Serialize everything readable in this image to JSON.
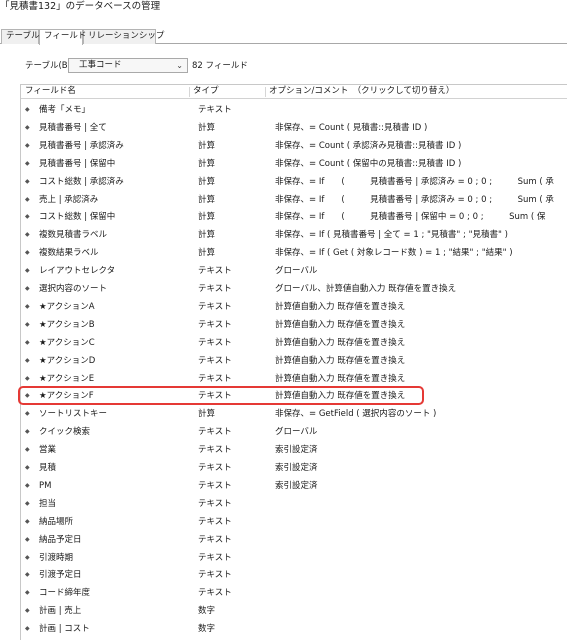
{
  "window": {
    "title": "「見積書132」のデータベースの管理"
  },
  "tabs": [
    {
      "label": "テーブル"
    },
    {
      "label": "フィールド"
    },
    {
      "label": "リレーションシップ"
    }
  ],
  "table_selector": {
    "label": "テーブル(B):",
    "selected": "工事コード",
    "field_count": "82 フィールド"
  },
  "columns": {
    "name": "フィールド名",
    "type": "タイプ",
    "options": "オプション/コメント　（クリックして切り替え）"
  },
  "rows": [
    {
      "name": "備考「メモ」",
      "type": "テキスト",
      "opt": ""
    },
    {
      "name": "見積書番号 | 全て",
      "type": "計算",
      "opt": "非保存、= Count ( 見積書::見積書 ID )"
    },
    {
      "name": "見積書番号 | 承認済み",
      "type": "計算",
      "opt": "非保存、= Count ( 承認済み見積書::見積書 ID )"
    },
    {
      "name": "見積書番号 | 保留中",
      "type": "計算",
      "opt": "非保存、= Count ( 保留中の見積書::見積書 ID )"
    },
    {
      "name": "コスト総数 | 承認済み",
      "type": "計算",
      "opt": "非保存、= If　　(　　　見積書番号 | 承認済み = 0 ; 0 ;　　　Sum ( 承"
    },
    {
      "name": "売上 | 承認済み",
      "type": "計算",
      "opt": "非保存、= If　　(　　　見積書番号 | 承認済み = 0 ; 0 ;　　　Sum ( 承"
    },
    {
      "name": "コスト総数 | 保留中",
      "type": "計算",
      "opt": "非保存、= If　　(　　　見積書番号 | 保留中 = 0 ; 0 ;　　　Sum ( 保"
    },
    {
      "name": "複数見積書ラベル",
      "type": "計算",
      "opt": "非保存、= If ( 見積書番号 | 全て = 1 ; \"見積書\" ; \"見積書\" )"
    },
    {
      "name": "複数結果ラベル",
      "type": "計算",
      "opt": "非保存、= If ( Get ( 対象レコード数 ) = 1 ; \"結果\" ; \"結果\" )"
    },
    {
      "name": "レイアウトセレクタ",
      "type": "テキスト",
      "opt": "グローバル"
    },
    {
      "name": "選択内容のソート",
      "type": "テキスト",
      "opt": "グローバル、計算値自動入力 既存値を置き換え"
    },
    {
      "name": "★アクションA",
      "type": "テキスト",
      "opt": "計算値自動入力 既存値を置き換え"
    },
    {
      "name": "★アクションB",
      "type": "テキスト",
      "opt": "計算値自動入力 既存値を置き換え"
    },
    {
      "name": "★アクションC",
      "type": "テキスト",
      "opt": "計算値自動入力 既存値を置き換え"
    },
    {
      "name": "★アクションD",
      "type": "テキスト",
      "opt": "計算値自動入力 既存値を置き換え"
    },
    {
      "name": "★アクションE",
      "type": "テキスト",
      "opt": "計算値自動入力 既存値を置き換え"
    },
    {
      "name": "★アクションF",
      "type": "テキスト",
      "opt": "計算値自動入力 既存値を置き換え"
    },
    {
      "name": "ソートリストキー",
      "type": "計算",
      "opt": "非保存、= GetField ( 選択内容のソート )"
    },
    {
      "name": "クイック検索",
      "type": "テキスト",
      "opt": "グローバル"
    },
    {
      "name": "営業",
      "type": "テキスト",
      "opt": "索引設定済"
    },
    {
      "name": "見積",
      "type": "テキスト",
      "opt": "索引設定済"
    },
    {
      "name": "PM",
      "type": "テキスト",
      "opt": "索引設定済"
    },
    {
      "name": "担当",
      "type": "テキスト",
      "opt": ""
    },
    {
      "name": "納品場所",
      "type": "テキスト",
      "opt": ""
    },
    {
      "name": "納品予定日",
      "type": "テキスト",
      "opt": ""
    },
    {
      "name": "引渡時期",
      "type": "テキスト",
      "opt": ""
    },
    {
      "name": "引渡予定日",
      "type": "テキスト",
      "opt": ""
    },
    {
      "name": "コード締年度",
      "type": "テキスト",
      "opt": ""
    },
    {
      "name": "計画 | 売上",
      "type": "数字",
      "opt": ""
    },
    {
      "name": "計画 | コスト",
      "type": "数字",
      "opt": ""
    }
  ],
  "highlight": {
    "color": "#e53935"
  }
}
